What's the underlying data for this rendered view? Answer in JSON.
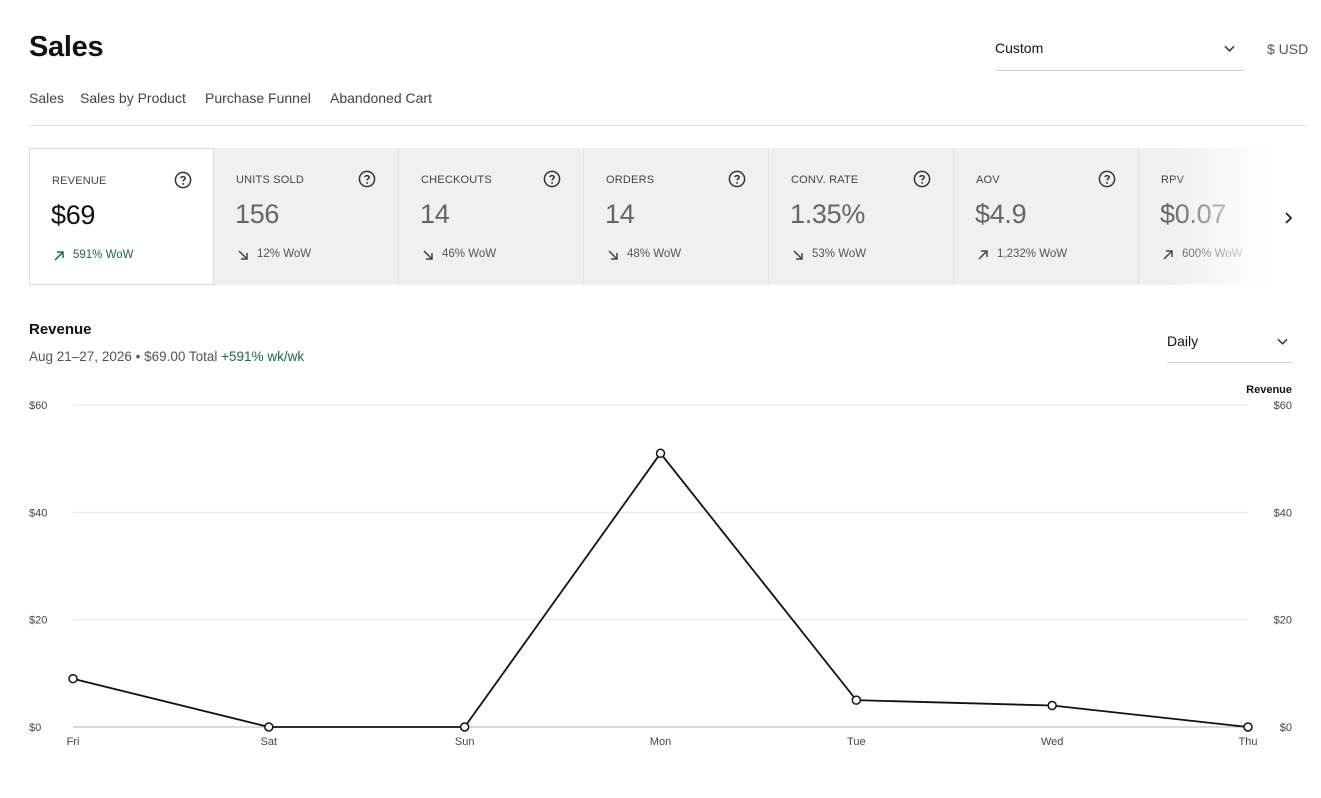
{
  "page": {
    "title": "Sales"
  },
  "header": {
    "date_range": "Custom",
    "currency": "$ USD"
  },
  "tabs": [
    {
      "label": "Sales",
      "active": true
    },
    {
      "label": "Sales by Product",
      "active": false
    },
    {
      "label": "Purchase Funnel",
      "active": false
    },
    {
      "label": "Abandoned Cart",
      "active": false
    }
  ],
  "metrics": [
    {
      "label": "REVENUE",
      "value": "$69",
      "change": "591% WoW",
      "direction": "up",
      "active": true
    },
    {
      "label": "UNITS SOLD",
      "value": "156",
      "change": "12% WoW",
      "direction": "down",
      "active": false
    },
    {
      "label": "CHECKOUTS",
      "value": "14",
      "change": "46% WoW",
      "direction": "down",
      "active": false
    },
    {
      "label": "ORDERS",
      "value": "14",
      "change": "48% WoW",
      "direction": "down",
      "active": false
    },
    {
      "label": "CONV. RATE",
      "value": "1.35%",
      "change": "53% WoW",
      "direction": "down",
      "active": false
    },
    {
      "label": "AOV",
      "value": "$4.9",
      "change": "1,232% WoW",
      "direction": "up",
      "active": false
    },
    {
      "label": "RPV",
      "value": "$0.07",
      "change": "600% WoW",
      "direction": "up",
      "active": false
    }
  ],
  "chart_section": {
    "title": "Revenue",
    "subtitle": "Aug 21–27, 2026 • $69.00 Total",
    "change": "+591% wk/wk",
    "interval": "Daily"
  },
  "colors": {
    "accent_green": "#1a6b3f",
    "line": "#111111"
  },
  "icons": {
    "help": "question-circle-icon",
    "up": "arrow-up-right-icon",
    "down": "arrow-down-right-icon",
    "next": "chevron-right-icon",
    "dropdown": "chevron-down-icon"
  },
  "chart_data": {
    "type": "line",
    "categories": [
      "Fri",
      "Sat",
      "Sun",
      "Mon",
      "Tue",
      "Wed",
      "Thu"
    ],
    "series": [
      {
        "name": "Revenue",
        "values": [
          9,
          0,
          0,
          51,
          5,
          4,
          0
        ]
      }
    ],
    "ylim": [
      0,
      60
    ],
    "yticks": [
      0,
      20,
      40,
      60
    ],
    "ytick_labels": [
      "$0",
      "$20",
      "$40",
      "$60"
    ],
    "legend": "top-right",
    "grid": true
  }
}
